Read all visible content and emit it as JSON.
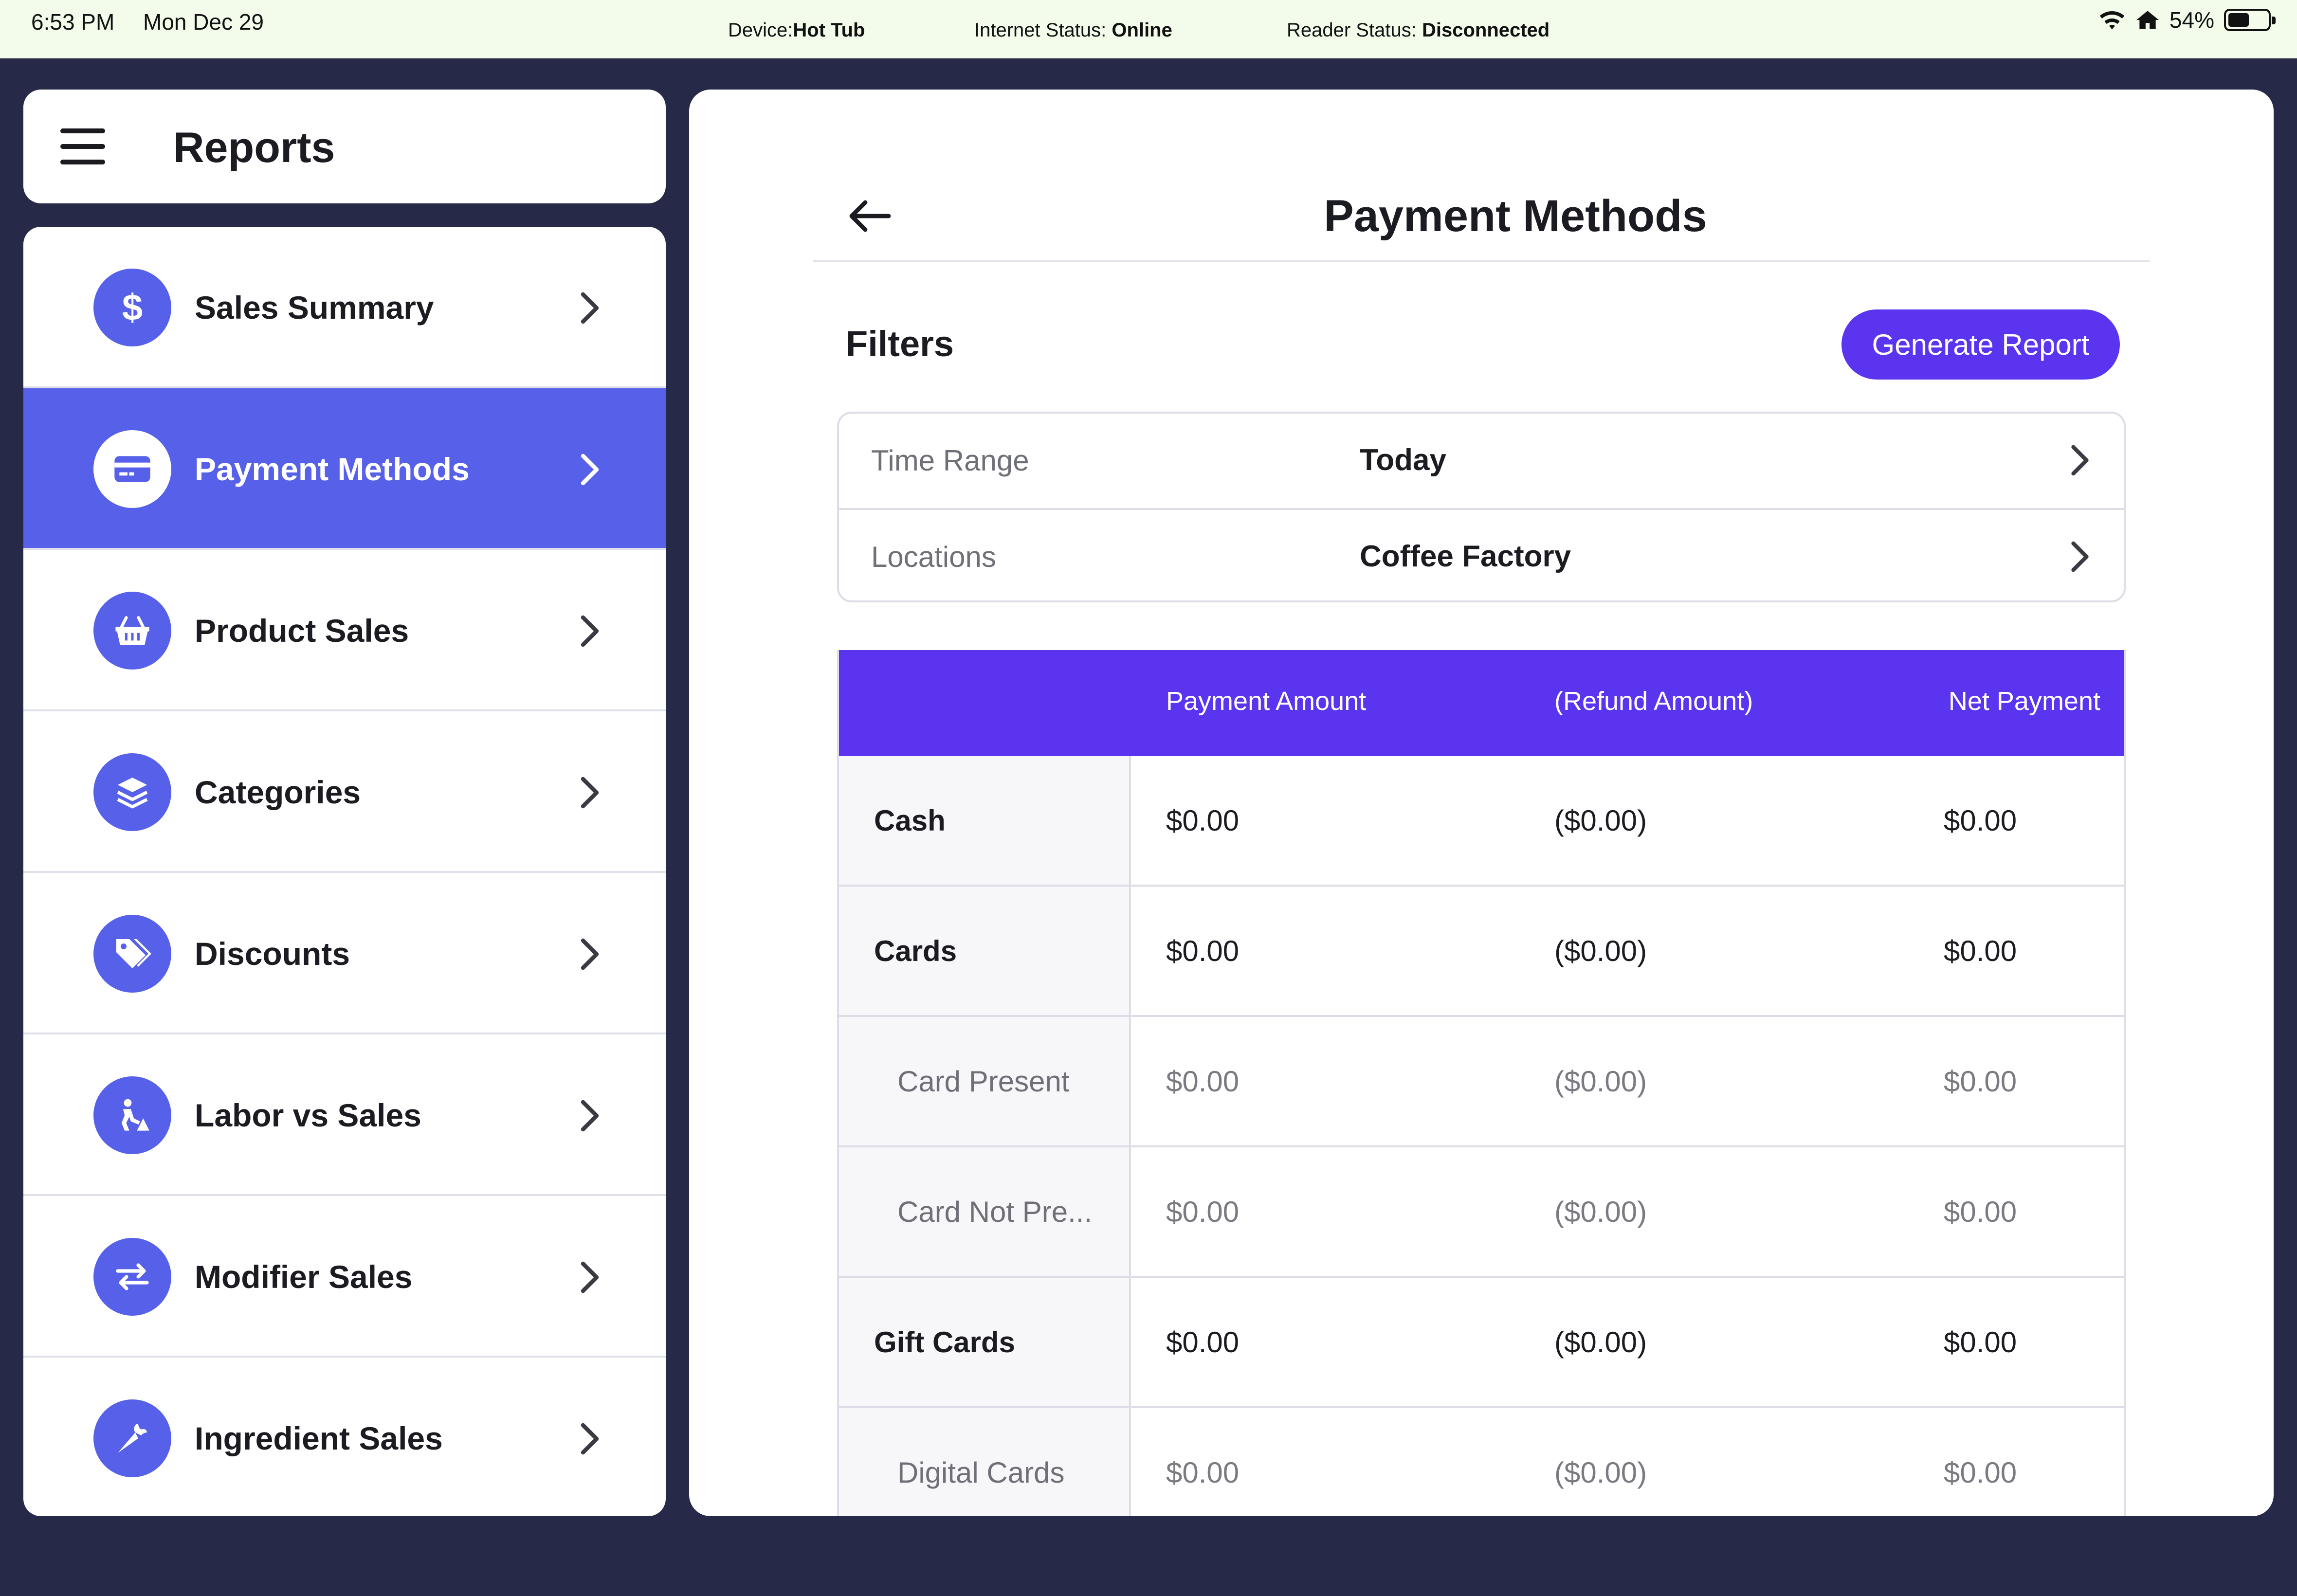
{
  "status_bar": {
    "time": "6:53 PM",
    "date": "Mon Dec 29",
    "device_label": "Device:",
    "device_value": "Hot Tub",
    "internet_label": "Internet Status:",
    "internet_value": "Online",
    "reader_label": "Reader Status:",
    "reader_value": "Disconnected",
    "battery": "54%",
    "battery_level": 0.54
  },
  "header": {
    "title": "Reports"
  },
  "sidebar": {
    "items": [
      {
        "label": "Sales Summary",
        "icon": "dollar-icon",
        "active": false
      },
      {
        "label": "Payment Methods",
        "icon": "credit-card-icon",
        "active": true
      },
      {
        "label": "Product Sales",
        "icon": "basket-icon",
        "active": false
      },
      {
        "label": "Categories",
        "icon": "layers-icon",
        "active": false
      },
      {
        "label": "Discounts",
        "icon": "tags-icon",
        "active": false
      },
      {
        "label": "Labor vs Sales",
        "icon": "worker-icon",
        "active": false
      },
      {
        "label": "Modifier Sales",
        "icon": "swap-arrows-icon",
        "active": false
      },
      {
        "label": "Ingredient Sales",
        "icon": "carrot-icon",
        "active": false
      }
    ]
  },
  "main": {
    "title": "Payment Methods",
    "filters_label": "Filters",
    "generate_button": "Generate Report",
    "filters": [
      {
        "key": "Time Range",
        "value": "Today"
      },
      {
        "key": "Locations",
        "value": "Coffee Factory"
      }
    ],
    "table": {
      "headers": [
        "",
        "Payment Amount",
        "(Refund Amount)",
        "Net Payment"
      ],
      "rows": [
        {
          "label": "Cash",
          "payment": "$0.00",
          "refund": "($0.00)",
          "net": "$0.00",
          "sub": false
        },
        {
          "label": "Cards",
          "payment": "$0.00",
          "refund": "($0.00)",
          "net": "$0.00",
          "sub": false
        },
        {
          "label": "Card Present",
          "payment": "$0.00",
          "refund": "($0.00)",
          "net": "$0.00",
          "sub": true
        },
        {
          "label": "Card Not Pre...",
          "payment": "$0.00",
          "refund": "($0.00)",
          "net": "$0.00",
          "sub": true
        },
        {
          "label": "Gift Cards",
          "payment": "$0.00",
          "refund": "($0.00)",
          "net": "$0.00",
          "sub": false
        },
        {
          "label": "Digital Cards",
          "payment": "$0.00",
          "refund": "($0.00)",
          "net": "$0.00",
          "sub": true
        }
      ]
    }
  },
  "colors": {
    "accent": "#5b34ef",
    "nav_accent": "#5760e8",
    "background": "#262a48",
    "status_bar": "#f3fbea"
  }
}
